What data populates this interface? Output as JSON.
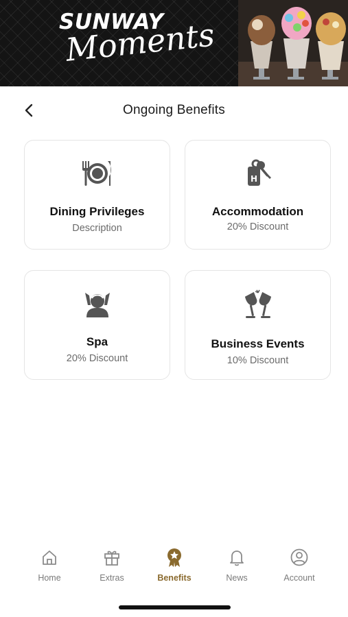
{
  "banner": {
    "brand_title": "SUNWAY",
    "brand_subtitle": "Moments"
  },
  "header": {
    "back_icon": "chevron-left-icon",
    "title": "Ongoing Benefits"
  },
  "cards": [
    {
      "icon": "dining-plate-icon",
      "title": "Dining Privileges",
      "subtitle": "Description"
    },
    {
      "icon": "hotel-key-icon",
      "title": "Accommodation",
      "subtitle": "20% Discount"
    },
    {
      "icon": "spa-icon",
      "title": "Spa",
      "subtitle": "20% Discount"
    },
    {
      "icon": "champagne-toast-icon",
      "title": "Business Events",
      "subtitle": "10% Discount"
    }
  ],
  "nav": {
    "items": [
      {
        "label": "Home",
        "icon": "home-icon",
        "active": false
      },
      {
        "label": "Extras",
        "icon": "gift-icon",
        "active": false
      },
      {
        "label": "Benefits",
        "icon": "benefits-badge-icon",
        "active": true
      },
      {
        "label": "News",
        "icon": "bell-icon",
        "active": false
      },
      {
        "label": "Account",
        "icon": "account-icon",
        "active": false
      }
    ],
    "active_color": "#8a6a2e",
    "inactive_color": "#7a7a7a"
  },
  "colors": {
    "banner_bg": "#141414",
    "card_border": "#e4e4e4",
    "icon_gray": "#555555"
  }
}
